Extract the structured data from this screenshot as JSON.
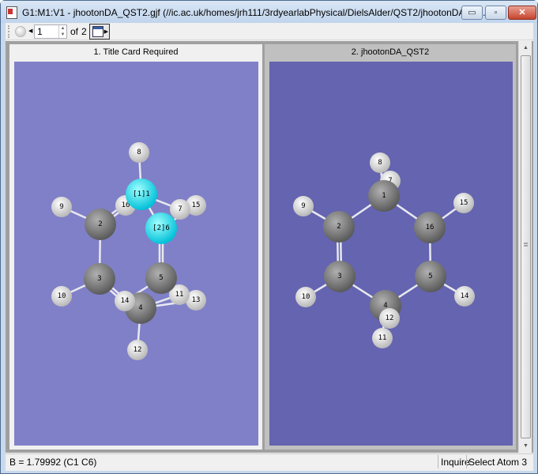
{
  "window": {
    "title": "G1:M1:V1 - jhootonDA_QST2.gjf (//ic.ac.uk/homes/jrh111/3rdyearlabPhysical/DielsAlder/QST2/jhootonDA_Q...",
    "minimize": "▭",
    "maximize": "▫",
    "close": "✕"
  },
  "toolbar": {
    "frame_value": "1",
    "of_label": "of",
    "total": "2"
  },
  "panels": [
    {
      "title": "1.  Title Card Required",
      "background": "#8080c8",
      "atoms": [
        {
          "id": "8",
          "el": "H"
        },
        {
          "id": "9",
          "el": "H"
        },
        {
          "id": "16",
          "el": "H"
        },
        {
          "id": "15",
          "el": "H"
        },
        {
          "id": "7",
          "el": "H"
        },
        {
          "id": "1",
          "el": "C",
          "label": "[1]1",
          "selected": true
        },
        {
          "id": "2",
          "el": "C"
        },
        {
          "id": "6",
          "el": "C",
          "label": "[2]6",
          "selected": true
        },
        {
          "id": "10",
          "el": "H"
        },
        {
          "id": "3",
          "el": "C"
        },
        {
          "id": "13",
          "el": "H"
        },
        {
          "id": "11",
          "el": "H"
        },
        {
          "id": "5",
          "el": "C"
        },
        {
          "id": "4",
          "el": "C"
        },
        {
          "id": "14",
          "el": "H"
        },
        {
          "id": "12",
          "el": "H"
        }
      ]
    },
    {
      "title": "2.  jhootonDA_QST2",
      "background": "#6464b0",
      "atoms": [
        {
          "id": "7",
          "el": "H"
        },
        {
          "id": "8",
          "el": "H"
        },
        {
          "id": "1",
          "el": "C"
        },
        {
          "id": "9",
          "el": "H"
        },
        {
          "id": "15",
          "el": "H"
        },
        {
          "id": "2",
          "el": "C"
        },
        {
          "id": "16",
          "el": "C"
        },
        {
          "id": "3",
          "el": "C"
        },
        {
          "id": "5",
          "el": "C"
        },
        {
          "id": "10",
          "el": "H"
        },
        {
          "id": "14",
          "el": "H"
        },
        {
          "id": "11",
          "el": "H"
        },
        {
          "id": "4",
          "el": "C"
        },
        {
          "id": "12",
          "el": "H"
        }
      ]
    }
  ],
  "colors": {
    "carbon": "#6e6e6e",
    "hydrogen": "#e8e8e8",
    "selected": "#00d8e8"
  },
  "status": {
    "left": "B = 1.79992 (C1 C6)",
    "mode": "Inquire",
    "hint": "Select Atom 3"
  }
}
